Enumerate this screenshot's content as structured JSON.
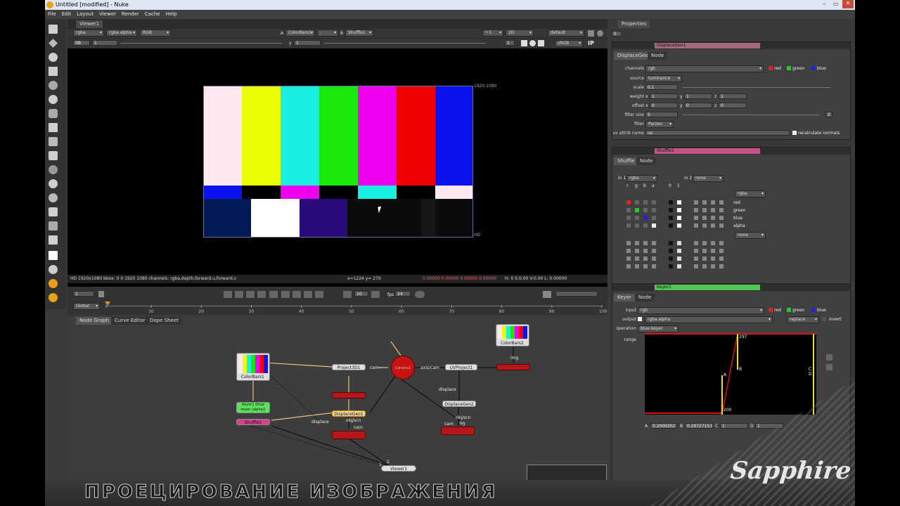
{
  "window": {
    "title": "Untitled [modified] - Nuke"
  },
  "menu": [
    "File",
    "Edit",
    "Layout",
    "Viewer",
    "Render",
    "Cache",
    "Help"
  ],
  "viewer": {
    "tab": "Viewer1",
    "channels": "rgba",
    "alpha": "rgba.alpha",
    "display": "RGB",
    "a_label": "A",
    "a_input": "ColorBars1",
    "op": "-",
    "b_label": "B",
    "b_input": "Shuffle1",
    "scale": "÷3",
    "view": "2D",
    "lut": "default",
    "fstop": "0B",
    "gain": "1",
    "y_label": "y",
    "gamma": "1",
    "frame": "1",
    "colorspace": "sRGB",
    "ip": "IP",
    "format_label": "1920,1080",
    "hd_label": "HD",
    "info": "HD 1920x1080 bbox: 0 0 1920 1080 channels: rgba,depth,forward.u,forward.v",
    "coords": "x=1224 y= 270",
    "rgba_vals": "0.00000  0.00000  0.00000  0.00000",
    "hsvl": "H: 0 S:0.00 V:0.00  L: 0.00000"
  },
  "timeline": {
    "frame": "1",
    "play_frame": "10",
    "fps_label": "fps",
    "fps": "24",
    "global": "Global",
    "ticks": [
      "1",
      "10",
      "20",
      "30",
      "40",
      "50",
      "60",
      "70",
      "80",
      "90",
      "100"
    ]
  },
  "nodegraph": {
    "tabs": [
      "Node Graph",
      "Curve Editor",
      "Dope Sheet"
    ],
    "nodes": {
      "colorbars1": "ColorBars1",
      "colorbars2": "ColorBars2",
      "keyer1": "Keyer1 (blue keyer (alpha))",
      "shuffle1": "Shuffle1",
      "project3d1": "Project3D1",
      "camera1": "Camera1",
      "uvproject1": "UVProject1",
      "displacegeo1": "DisplaceGeo1",
      "displacegeo2": "DisplaceGeo2",
      "viewer1": "Viewer1"
    },
    "labels": {
      "cam": "cam",
      "axis_cam": "axis/cam",
      "img": "img",
      "displace1": "displace",
      "displace2": "displace",
      "obj_scn1": "obj/scn",
      "cam2": "cam",
      "obj_scn2": "obj/scn",
      "bg": "bg",
      "cam3": "cam",
      "n1": "1",
      "n2": "2"
    }
  },
  "properties": {
    "title": "Properties",
    "count": "5",
    "displace": {
      "name": "DisplaceGeo1",
      "tabs": [
        "DisplaceGeo",
        "Node"
      ],
      "channels_label": "channels",
      "channels": "rgb",
      "red": "red",
      "green": "green",
      "blue": "blue",
      "source_label": "source",
      "source": "luminance",
      "scale_label": "scale",
      "scale": "0.1",
      "weight_label": "weight",
      "weight_x": "1",
      "weight_y": "1",
      "weight_z": "1",
      "offset_label": "offset",
      "offset_x": "0",
      "offset_y": "0",
      "offset_z": "0",
      "filter_size_label": "filter size",
      "filter_size": "5",
      "filter_label": "filter",
      "filter": "Parzen",
      "uv_label": "uv attrib name",
      "uv": "uv",
      "recalc": "recalculate normals",
      "x": "x",
      "y": "y",
      "z": "z",
      "badge": "2"
    },
    "shuffle": {
      "name": "Shuffle1",
      "tabs": [
        "Shuffle",
        "Node"
      ],
      "in1_label": "in 1",
      "in1": "rgba",
      "in2_label": "in 2",
      "in2": "none",
      "cols": [
        "r",
        "g",
        "b",
        "a",
        "0",
        "1"
      ],
      "out1": "rgba",
      "out2": "none",
      "rows": [
        "red",
        "green",
        "blue",
        "alpha"
      ]
    },
    "keyer": {
      "name": "Keyer1",
      "tabs": [
        "Keyer",
        "Node"
      ],
      "input_label": "input",
      "input": "rgb",
      "red": "red",
      "green": "green",
      "blue": "blue",
      "output_label": "output",
      "output": "rgba.alpha",
      "op_mode": "replace",
      "invert": "invert",
      "operation_label": "operation",
      "operation": "blue keyer",
      "range_label": "range",
      "graph": {
        "top": "297",
        "bottom": "200",
        "a": "A",
        "b": "B",
        "c": "C",
        "d": "D"
      },
      "a_label": "A",
      "a_val": "0.2000202",
      "b_label": "B",
      "b_val": "0.29727153",
      "c_label": "C",
      "c_val": "1",
      "d_label": "D",
      "d_val": "1"
    }
  },
  "caption": "ПРОЕЦИРОВАНИЕ ИЗОБРАЖЕНИЯ",
  "brand": "Sapphire"
}
